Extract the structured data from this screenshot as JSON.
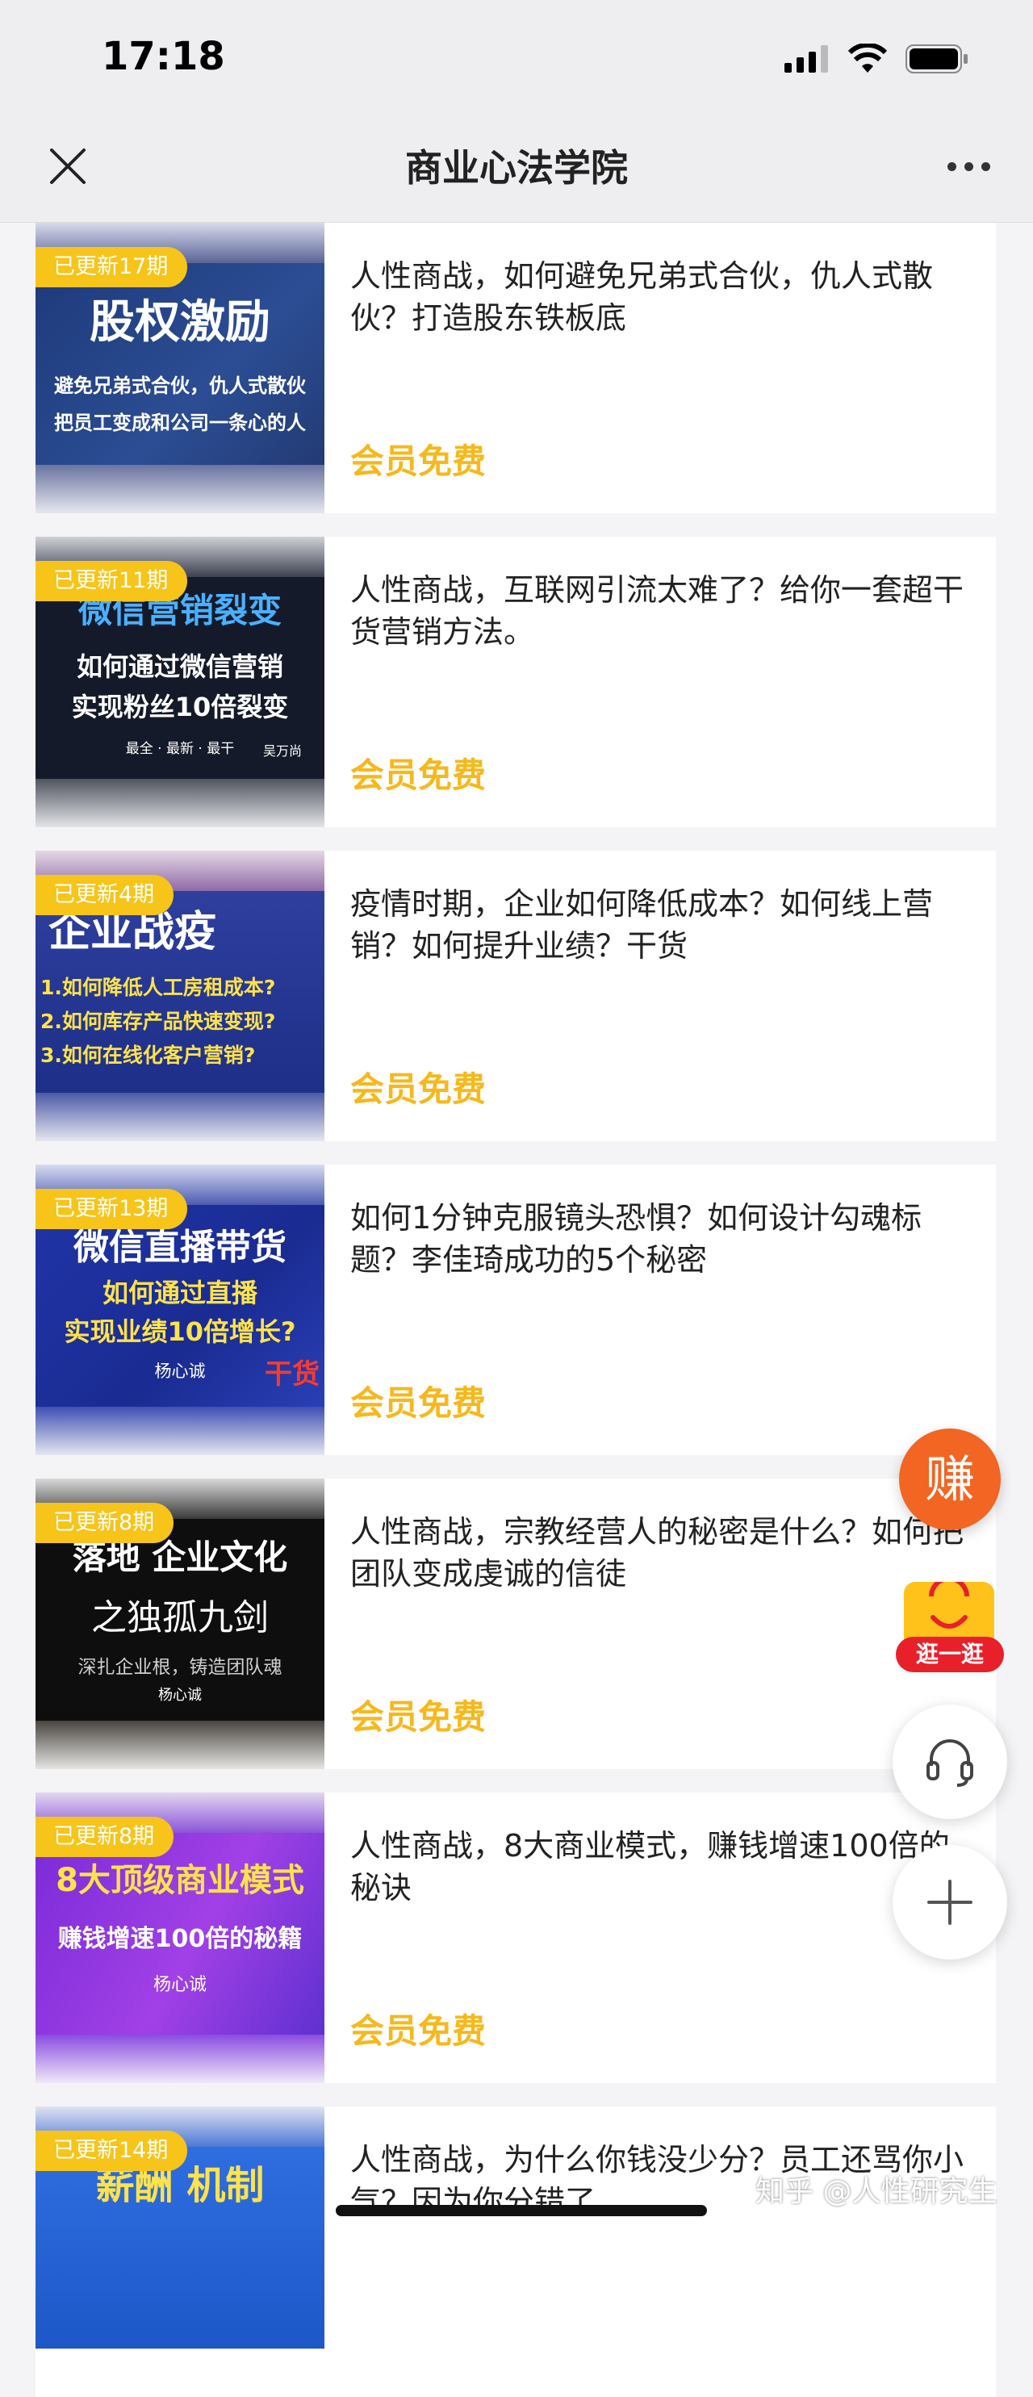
{
  "status_bar": {
    "time": "17:18"
  },
  "nav": {
    "title": "商业心法学院"
  },
  "courses": [
    {
      "badge": "已更新17期",
      "thumb_line1": "股权激励",
      "thumb_line2": "避免兄弟式合伙，仇人式散伙",
      "thumb_line3": "把员工变成和公司一条心的人",
      "title": "人性商战，如何避免兄弟式合伙，仇人式散伙？打造股东铁板底",
      "price": "会员免费"
    },
    {
      "badge": "已更新11期",
      "thumb_line1": "微信营销裂变",
      "thumb_line2": "如何通过微信营销",
      "thumb_line3": "实现粉丝10倍裂变",
      "thumb_line4": "最全 · 最新 · 最干",
      "thumb_author": "吴万尚",
      "title": "人性商战，互联网引流太难了？给你一套超干货营销方法。",
      "price": "会员免费"
    },
    {
      "badge": "已更新4期",
      "thumb_line1": "企业战疫",
      "thumb_line2": "1.如何降低人工房租成本?",
      "thumb_line3": "2.如何库存产品快速变现?",
      "thumb_line4": "3.如何在线化客户营销?",
      "title": "疫情时期，企业如何降低成本？如何线上营销？如何提升业绩？干货",
      "price": "会员免费"
    },
    {
      "badge": "已更新13期",
      "thumb_line1": "微信直播带货",
      "thumb_line2": "如何通过直播",
      "thumb_line3": "实现业绩10倍增长?",
      "thumb_author": "杨心诚",
      "thumb_tag": "干货",
      "title": "如何1分钟克服镜头恐惧？如何设计勾魂标题？李佳琦成功的5个秘密",
      "price": "会员免费"
    },
    {
      "badge": "已更新8期",
      "thumb_line1": "落地 企业文化",
      "thumb_line2": "之独孤九剑",
      "thumb_line3": "深扎企业根，铸造团队魂",
      "thumb_author": "杨心诚",
      "title": "人性商战，宗教经营人的秘密是什么？如何把团队变成虔诚的信徒",
      "price": "会员免费"
    },
    {
      "badge": "已更新8期",
      "thumb_line1": "8大顶级商业模式",
      "thumb_line2": "赚钱增速100倍的秘籍",
      "thumb_author": "杨心诚",
      "title": "人性商战，8大商业模式，赚钱增速100倍的秘诀",
      "price": "会员免费"
    },
    {
      "badge": "已更新14期",
      "thumb_line1": "薪酬 机制",
      "title": "人性商战，为什么你钱没少分？员工还骂你小气？因为你分错了",
      "price": ""
    }
  ],
  "floating": {
    "earn": "赚",
    "shop": "逛一逛"
  },
  "watermark": "知乎 @人性研究生"
}
